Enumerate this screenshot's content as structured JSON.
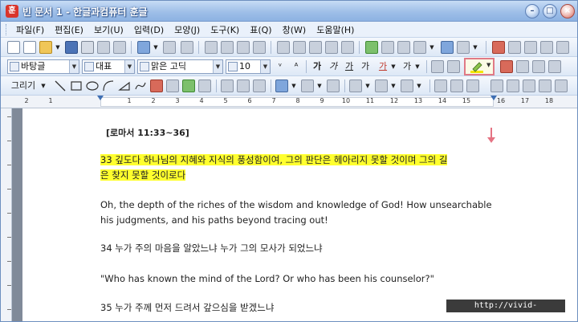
{
  "window": {
    "title": "빈 문서 1 - 한글과컴퓨터 훈글",
    "app_icon": "훈"
  },
  "menu": {
    "items": [
      "파일(F)",
      "편집(E)",
      "보기(U)",
      "입력(D)",
      "모양(J)",
      "도구(K)",
      "표(Q)",
      "창(W)",
      "도움말(H)"
    ]
  },
  "format_bar": {
    "style_value": "바탕글",
    "lang_value": "대표",
    "font_value": "맑은 고딕",
    "size_value": "10",
    "highlighter_color": "#f2e500"
  },
  "draw_bar": {
    "draw_label": "그리기"
  },
  "ruler": {
    "numbers": [
      "2",
      "1",
      "1",
      "2",
      "3",
      "4",
      "5",
      "6",
      "7",
      "8",
      "9",
      "10",
      "11",
      "12",
      "13",
      "14",
      "15",
      "16",
      "17",
      "18"
    ]
  },
  "document": {
    "heading": "[로마서 11:33~36]",
    "v33_line1": "33 깊도다 하나님의 지혜와 지식의 풍성함이여, 그의 판단은 헤아리지 못할 것이며 그의 길",
    "v33_line2": "은 찾지 못할 것이로다",
    "en33_line1": "Oh, the depth of the riches of the wisdom and knowledge of God! How unsearchable",
    "en33_line2": "his judgments, and his paths beyond tracing out!",
    "v34": "34 누가 주의 마음을 알았느냐 누가 그의 모사가 되었느냐",
    "en34": "\"Who has known the mind of the Lord? Or who has been his counselor?\"",
    "v35": "35 누가 주께 먼저 드려서 갚으심을 받겠느냐",
    "highlight_color": "#ffff2e"
  },
  "watermark": "http://vivid-daily.tistory.com"
}
